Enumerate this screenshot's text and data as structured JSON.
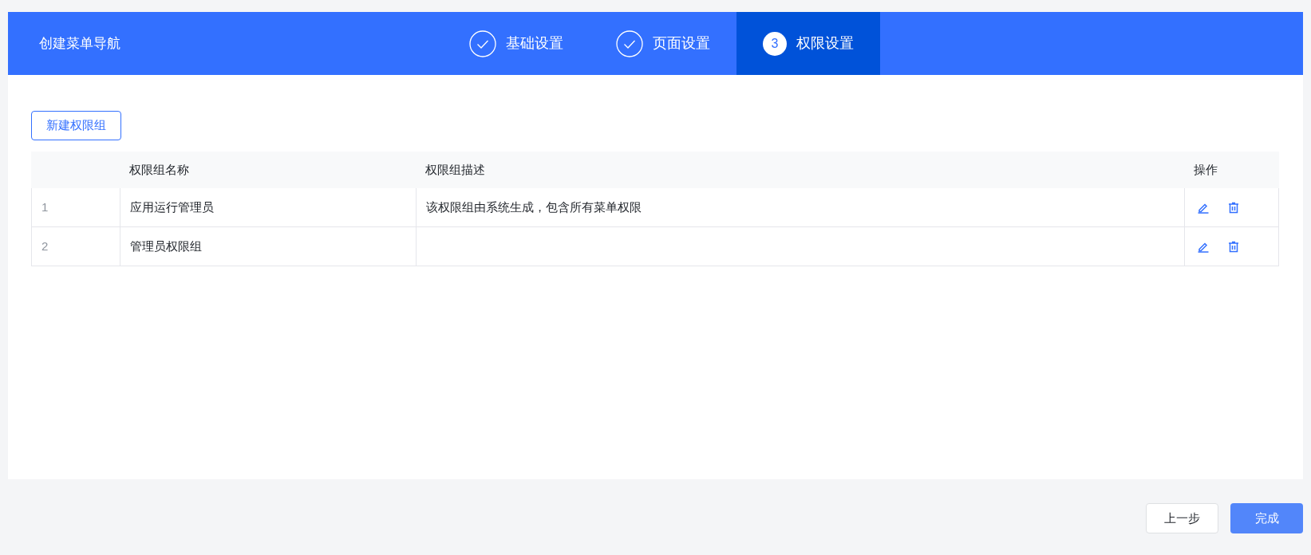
{
  "header": {
    "title": "创建菜单导航"
  },
  "steps": [
    {
      "label": "基础设置",
      "completed": true,
      "selected": false
    },
    {
      "label": "页面设置",
      "completed": true,
      "selected": false
    },
    {
      "label": "权限设置",
      "completed": false,
      "selected": true,
      "number": "3"
    }
  ],
  "new_button": "新建权限组",
  "table": {
    "columns": [
      "",
      "权限组名称",
      "权限组描述",
      "操作"
    ],
    "rows": [
      {
        "index": "1",
        "name": "应用运行管理员",
        "description": "该权限组由系统生成，包含所有菜单权限"
      },
      {
        "index": "2",
        "name": "管理员权限组",
        "description": ""
      }
    ]
  },
  "footer": {
    "buttons": [
      {
        "label": "上一步",
        "kind": "secondary"
      },
      {
        "label": "完成",
        "kind": "primary"
      }
    ]
  }
}
